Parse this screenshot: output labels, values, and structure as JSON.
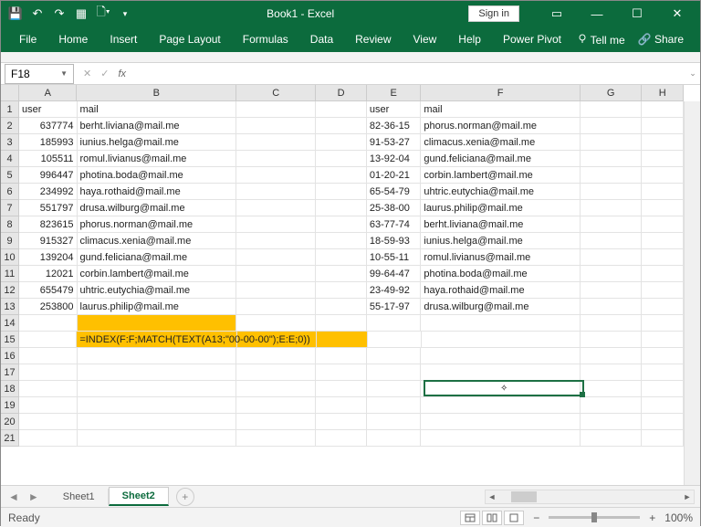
{
  "title": "Book1 - Excel",
  "signin": "Sign in",
  "ribbon": {
    "tabs": [
      "File",
      "Home",
      "Insert",
      "Page Layout",
      "Formulas",
      "Data",
      "Review",
      "View",
      "Help",
      "Power Pivot"
    ],
    "tellme": "Tell me",
    "share": "Share"
  },
  "name_box": "F18",
  "status": "Ready",
  "zoom": "100%",
  "sheets": {
    "items": [
      "Sheet1",
      "Sheet2"
    ],
    "active": 1
  },
  "col_widths": {
    "A": 64,
    "B": 176,
    "C": 88,
    "D": 56,
    "E": 60,
    "F": 176,
    "G": 68,
    "H": 46
  },
  "cols": [
    "A",
    "B",
    "C",
    "D",
    "E",
    "F",
    "G",
    "H"
  ],
  "row_count": 21,
  "formula_text": "=INDEX(F:F;MATCH(TEXT(A13;\"00-00-00\");E:E;0))",
  "formula_cell_row": 15,
  "formula_yellow_row": 14,
  "selected": {
    "col": "F",
    "row": 18
  },
  "headers": {
    "A": "user",
    "B": "mail",
    "E": "user",
    "F": "mail"
  },
  "rows": [
    {
      "A": "637774",
      "B": "berht.liviana@mail.me",
      "E": "82-36-15",
      "F": "phorus.norman@mail.me"
    },
    {
      "A": "185993",
      "B": "iunius.helga@mail.me",
      "E": "91-53-27",
      "F": "climacus.xenia@mail.me"
    },
    {
      "A": "105511",
      "B": "romul.livianus@mail.me",
      "E": "13-92-04",
      "F": "gund.feliciana@mail.me"
    },
    {
      "A": "996447",
      "B": "photina.boda@mail.me",
      "E": "01-20-21",
      "F": "corbin.lambert@mail.me"
    },
    {
      "A": "234992",
      "B": "haya.rothaid@mail.me",
      "E": "65-54-79",
      "F": "uhtric.eutychia@mail.me"
    },
    {
      "A": "551797",
      "B": "drusa.wilburg@mail.me",
      "E": "25-38-00",
      "F": "laurus.philip@mail.me"
    },
    {
      "A": "823615",
      "B": "phorus.norman@mail.me",
      "E": "63-77-74",
      "F": "berht.liviana@mail.me"
    },
    {
      "A": "915327",
      "B": "climacus.xenia@mail.me",
      "E": "18-59-93",
      "F": "iunius.helga@mail.me"
    },
    {
      "A": "139204",
      "B": "gund.feliciana@mail.me",
      "E": "10-55-11",
      "F": "romul.livianus@mail.me"
    },
    {
      "A": "12021",
      "B": "corbin.lambert@mail.me",
      "E": "99-64-47",
      "F": "photina.boda@mail.me"
    },
    {
      "A": "655479",
      "B": "uhtric.eutychia@mail.me",
      "E": "23-49-92",
      "F": "haya.rothaid@mail.me"
    },
    {
      "A": "253800",
      "B": "laurus.philip@mail.me",
      "E": "55-17-97",
      "F": "drusa.wilburg@mail.me"
    }
  ]
}
